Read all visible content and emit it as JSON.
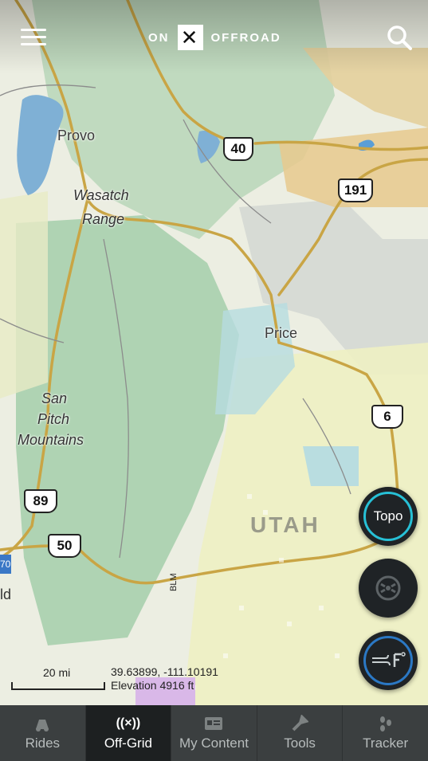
{
  "header": {
    "logo_left": "ON",
    "logo_mark": "✕",
    "logo_right": "OFFROAD"
  },
  "map": {
    "places": [
      "Provo",
      "Wasatch",
      "Range",
      "Price",
      "San",
      "Pitch",
      "Mountains"
    ],
    "state": "UTAH",
    "highways": [
      "40",
      "191",
      "6",
      "89",
      "50"
    ],
    "blm": "BLM",
    "edge_labels": [
      "ld",
      "70"
    ]
  },
  "layers": {
    "topo_label": "Topo"
  },
  "scale": {
    "label": "20 mi"
  },
  "location": {
    "coords": "39.63899, -111.10191",
    "elevation": "Elevation 4916 ft"
  },
  "nav": {
    "items": [
      {
        "label": "Rides",
        "icon": "rides-icon"
      },
      {
        "label": "Off-Grid",
        "icon": "off-grid-icon"
      },
      {
        "label": "My Content",
        "icon": "my-content-icon"
      },
      {
        "label": "Tools",
        "icon": "tools-icon"
      },
      {
        "label": "Tracker",
        "icon": "tracker-icon"
      }
    ],
    "active": "Off-Grid"
  },
  "colors": {
    "accent": "#27c0d6",
    "navbar": "#3b3f40",
    "nav_active": "#1d2021"
  }
}
